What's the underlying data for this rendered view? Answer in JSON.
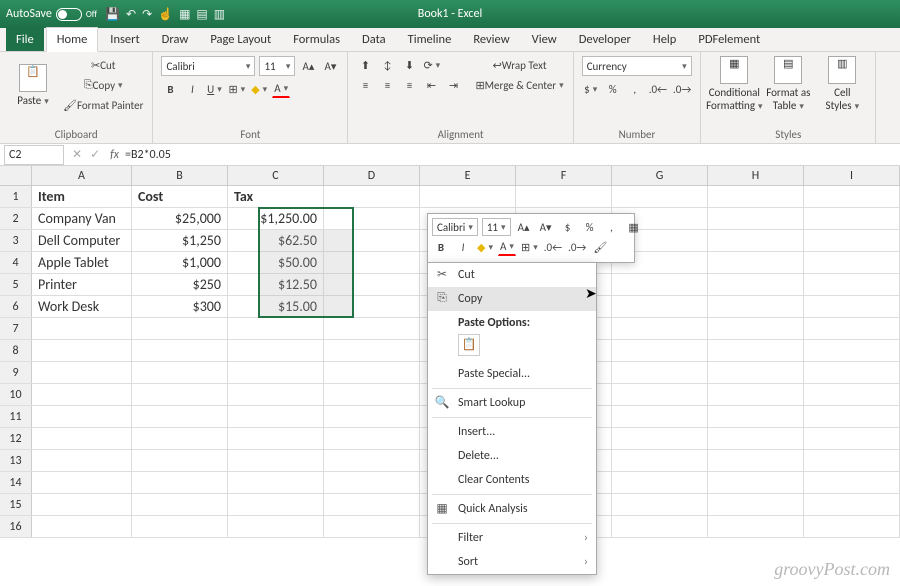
{
  "titlebar": {
    "autosave": "AutoSave",
    "off": "Off",
    "title": "Book1 - Excel"
  },
  "tabs": [
    "File",
    "Home",
    "Insert",
    "Draw",
    "Page Layout",
    "Formulas",
    "Data",
    "Timeline",
    "Review",
    "View",
    "Developer",
    "Help",
    "PDFelement"
  ],
  "activeTab": 1,
  "ribbon": {
    "clipboard": {
      "paste": "Paste",
      "cut": "Cut",
      "copy": "Copy",
      "fmt": "Format Painter",
      "label": "Clipboard"
    },
    "font": {
      "name": "Calibri",
      "size": "11",
      "label": "Font"
    },
    "align": {
      "wrap": "Wrap Text",
      "merge": "Merge & Center",
      "label": "Alignment"
    },
    "number": {
      "fmt": "Currency",
      "label": "Number"
    },
    "styles": {
      "cf": "Conditional Formatting",
      "ft": "Format as Table",
      "cs": "Cell Styles",
      "label": "Styles"
    }
  },
  "formula": {
    "name": "C2",
    "fx": "fx",
    "value": "=B2*0.05"
  },
  "cols": [
    "A",
    "B",
    "C",
    "D",
    "E",
    "F",
    "G",
    "H",
    "I"
  ],
  "rows": [
    {
      "n": "1",
      "a": "Item",
      "b": "Cost",
      "c": "Tax",
      "bold": true
    },
    {
      "n": "2",
      "a": "Company Van",
      "b": "$25,000",
      "c": "$1,250.00"
    },
    {
      "n": "3",
      "a": "Dell Computer",
      "b": "$1,250",
      "c": "$62.50"
    },
    {
      "n": "4",
      "a": "Apple Tablet",
      "b": "$1,000",
      "c": "$50.00"
    },
    {
      "n": "5",
      "a": "Printer",
      "b": "$250",
      "c": "$12.50"
    },
    {
      "n": "6",
      "a": "Work Desk",
      "b": "$300",
      "c": "$15.00"
    },
    {
      "n": "7"
    },
    {
      "n": "8"
    },
    {
      "n": "9"
    },
    {
      "n": "10"
    },
    {
      "n": "11"
    },
    {
      "n": "12"
    },
    {
      "n": "13"
    },
    {
      "n": "14"
    },
    {
      "n": "15"
    },
    {
      "n": "16"
    }
  ],
  "mini": {
    "font": "Calibri",
    "size": "11"
  },
  "ctx": {
    "cut": "Cut",
    "copy": "Copy",
    "popt": "Paste Options:",
    "pspecial": "Paste Special...",
    "lookup": "Smart Lookup",
    "insert": "Insert...",
    "delete": "Delete...",
    "clear": "Clear Contents",
    "quick": "Quick Analysis",
    "filter": "Filter",
    "sort": "Sort"
  },
  "watermark": "groovyPost.com"
}
